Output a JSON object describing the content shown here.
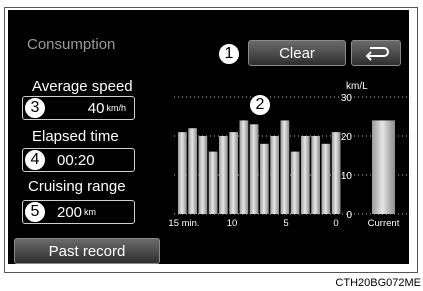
{
  "screen": {
    "title": "Consumption",
    "clear_label": "Clear",
    "back_icon": "return-arrow-icon",
    "average_speed": {
      "label": "Average speed",
      "value": "40",
      "unit": "km/h"
    },
    "elapsed_time": {
      "label": "Elapsed time",
      "value": "00:20"
    },
    "cruising_range": {
      "label": "Cruising range",
      "value": "200",
      "unit": "km"
    },
    "past_record_label": "Past record"
  },
  "callouts": [
    "1",
    "2",
    "3",
    "4",
    "5"
  ],
  "caption": "CTH20BG072ME",
  "chart_data": {
    "type": "bar",
    "ylabel": "km/L",
    "ylim": [
      0,
      30
    ],
    "yticks": [
      "0",
      "10",
      "20",
      "30"
    ],
    "xticks": [
      "15 min.",
      "10",
      "5",
      "0"
    ],
    "values": [
      21,
      22,
      20,
      16,
      20,
      21,
      24,
      23,
      18,
      20,
      24,
      16,
      20,
      20,
      18,
      21
    ],
    "current_label": "Current",
    "current_value": 24,
    "grid": true
  }
}
